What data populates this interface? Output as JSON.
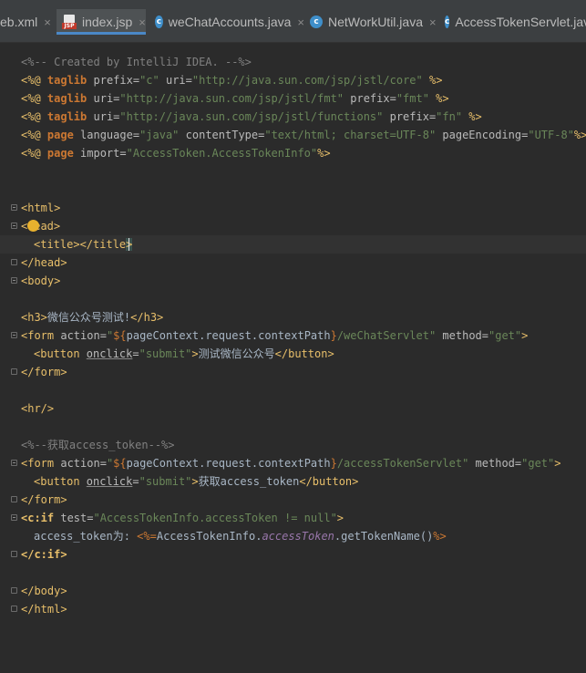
{
  "tabs": [
    {
      "name": "eb.xml",
      "icon": "xml-file-icon"
    },
    {
      "name": "index.jsp",
      "icon": "jsp-file-icon",
      "active": true
    },
    {
      "name": "weChatAccounts.java",
      "icon": "java-class-icon"
    },
    {
      "name": "NetWorkUtil.java",
      "icon": "java-class-icon"
    },
    {
      "name": "AccessTokenServlet.java",
      "icon": "java-class-icon"
    }
  ],
  "close_glyph": "×",
  "icon_letters": {
    "jsp": "JSP",
    "class": "c"
  },
  "code": {
    "l1": [
      "<%-- Created by IntelliJ IDEA. --%>"
    ],
    "l2": [
      "<%@ ",
      "taglib",
      " prefix=",
      "\"c\"",
      " uri=",
      "\"http://java.sun.com/jsp/jstl/core\"",
      " %>"
    ],
    "l3": [
      "<%@ ",
      "taglib",
      " uri=",
      "\"http://java.sun.com/jsp/jstl/fmt\"",
      " prefix=",
      "\"fmt\"",
      " %>"
    ],
    "l4": [
      "<%@ ",
      "taglib",
      " uri=",
      "\"http://java.sun.com/jsp/jstl/functions\"",
      " prefix=",
      "\"fn\"",
      " %>"
    ],
    "l5": [
      "<%@ ",
      "page",
      " language=",
      "\"java\"",
      " contentType=",
      "\"text/html; charset=UTF-8\"",
      " pageEncoding=",
      "\"UTF-8\"",
      "%>"
    ],
    "l6": [
      "<%@ ",
      "page",
      " import=",
      "\"AccessToken.AccessTokenInfo\"",
      "%>"
    ],
    "html_open": "<html>",
    "head_open_a": "<",
    "head_open_b": "ead>",
    "title_line": "<title></title",
    "title_close": ">",
    "head_close": "</head>",
    "body_open": "<body>",
    "h3": [
      "<h3>",
      "微信公众号测试!",
      "</h3>"
    ],
    "form1": [
      "<form ",
      "action=",
      "\"",
      "${",
      "pageContext.request.contextPath",
      "}",
      "/weChatServlet\"",
      " method=",
      "\"get\"",
      ">"
    ],
    "btn1": [
      "<button ",
      "onclick",
      "=",
      "\"submit\"",
      ">",
      "测试微信公众号",
      "</button>"
    ],
    "form_close": "</form>",
    "hr": "<hr/>",
    "comment2": "<%--获取access_token--%>",
    "form2": [
      "<form ",
      "action=",
      "\"",
      "${",
      "pageContext.request.contextPath",
      "}",
      "/accessTokenServlet\"",
      " method=",
      "\"get\"",
      ">"
    ],
    "btn2": [
      "<button ",
      "onclick",
      "=",
      "\"submit\"",
      ">",
      "获取access_token",
      "</button>"
    ],
    "form2_close": "</form>",
    "cif": [
      "<c:if ",
      "test=",
      "\"AccessTokenInfo.accessToken != null\"",
      ">"
    ],
    "token_line": [
      "access_token为: ",
      "<%=",
      "AccessTokenInfo.",
      "accessToken",
      ".getTokenName()",
      "%>"
    ],
    "cif_close": "</c:if>",
    "body_close": "</body>",
    "html_close": "</html>"
  }
}
